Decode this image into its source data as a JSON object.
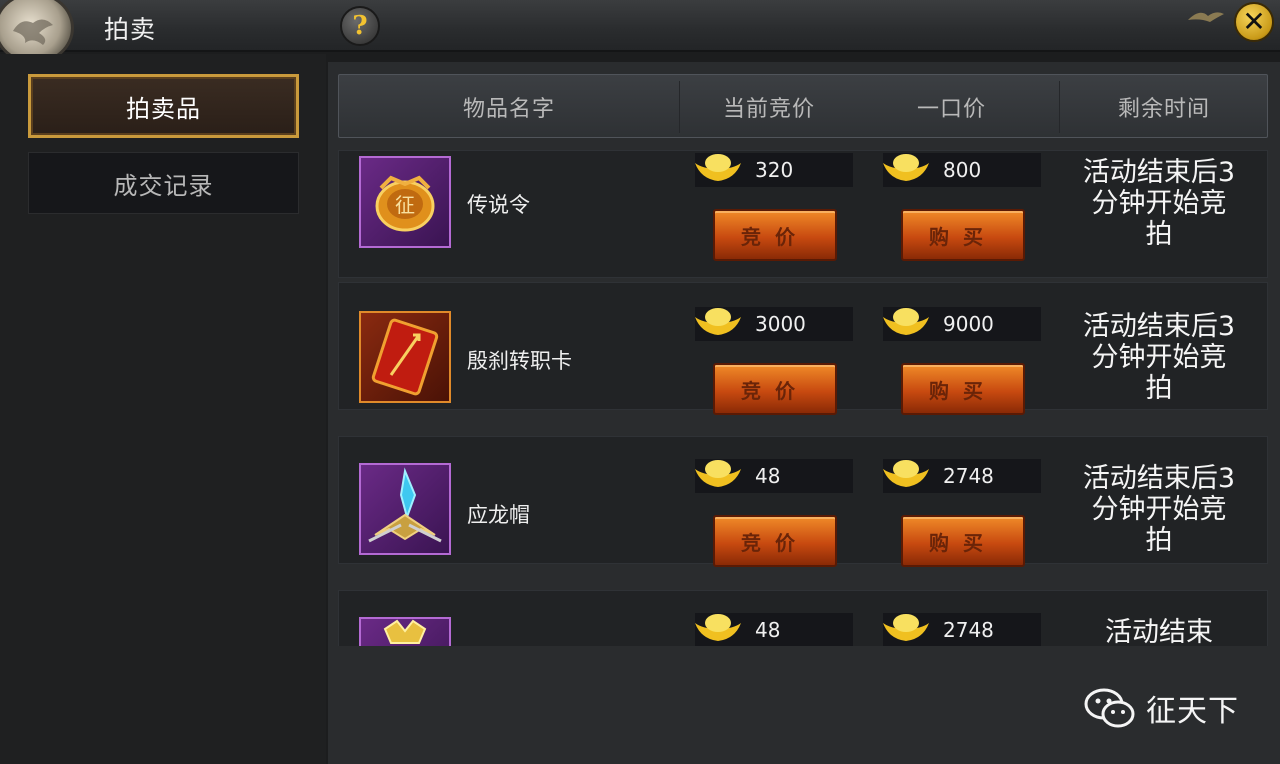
{
  "window": {
    "title": "拍卖",
    "help_glyph": "?",
    "close_glyph": "✕"
  },
  "sidebar": {
    "tabs": [
      {
        "label": "拍卖品",
        "active": true
      },
      {
        "label": "成交记录",
        "active": false
      }
    ]
  },
  "table": {
    "columns": [
      "物品名字",
      "当前竞价",
      "一口价",
      "剩余时间"
    ],
    "bid_label": "竞价",
    "buy_label": "购买",
    "rows": [
      {
        "name": "传说令",
        "icon": "token-medal-icon",
        "current_bid": "320",
        "buyout": "800",
        "time_left": "活动结束后3分钟开始竞拍"
      },
      {
        "name": "殷刹转职卡",
        "icon": "class-change-card-icon",
        "current_bid": "3000",
        "buyout": "9000",
        "time_left": "活动结束后3分钟开始竞拍"
      },
      {
        "name": "应龙帽",
        "icon": "dragon-helmet-icon",
        "current_bid": "48",
        "buyout": "2748",
        "time_left": "活动结束后3分钟开始竞拍"
      },
      {
        "name": "",
        "icon": "gold-armor-icon",
        "current_bid": "48",
        "buyout": "2748",
        "time_left": "活动结束"
      }
    ]
  },
  "watermark": {
    "text": "征天下",
    "icon": "wechat-icon"
  },
  "colors": {
    "accent_gold": "#c99a3c",
    "button_orange": "#e0701c",
    "panel_bg": "#2a2c2e"
  }
}
